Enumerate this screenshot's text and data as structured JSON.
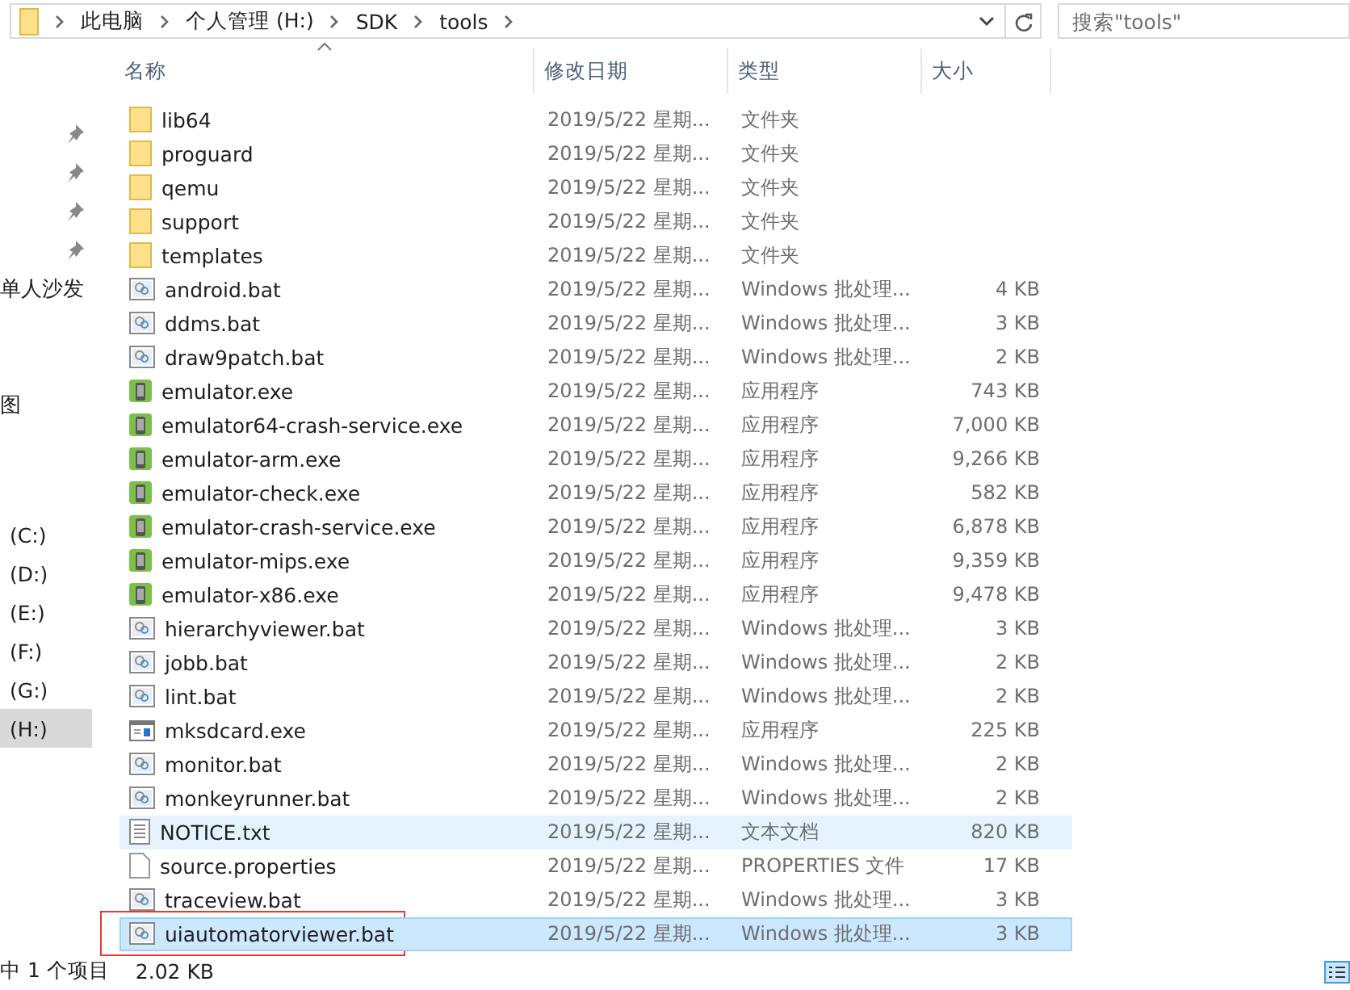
{
  "address_bar": {
    "crumbs": [
      "此电脑",
      "个人管理 (H:)",
      "SDK",
      "tools"
    ]
  },
  "search": {
    "placeholder": "搜索\"tools\""
  },
  "sidebar": {
    "quick_access": [
      {
        "pinned": true
      },
      {
        "pinned": true
      },
      {
        "pinned": true
      },
      {
        "pinned": true
      },
      {
        "label": "单人沙发",
        "pinned": false
      },
      {
        "pinned": false
      },
      {
        "pinned": false
      },
      {
        "label": "图",
        "pinned": false
      }
    ],
    "drives": [
      {
        "label": "(C:)",
        "selected": false
      },
      {
        "label": "(D:)",
        "selected": false
      },
      {
        "label": "(E:)",
        "selected": false
      },
      {
        "label": "(F:)",
        "selected": false
      },
      {
        "label": "(G:)",
        "selected": false
      },
      {
        "label": "(H:)",
        "selected": true
      }
    ]
  },
  "table": {
    "columns": [
      "名称",
      "修改日期",
      "类型",
      "大小"
    ],
    "rows": [
      {
        "kind": "folder",
        "name": "lib64",
        "date": "2019/5/22 星期...",
        "type": "文件夹",
        "size": "",
        "selected": false,
        "hovered": false,
        "annotated": false
      },
      {
        "kind": "folder",
        "name": "proguard",
        "date": "2019/5/22 星期...",
        "type": "文件夹",
        "size": "",
        "selected": false,
        "hovered": false,
        "annotated": false
      },
      {
        "kind": "folder",
        "name": "qemu",
        "date": "2019/5/22 星期...",
        "type": "文件夹",
        "size": "",
        "selected": false,
        "hovered": false,
        "annotated": false
      },
      {
        "kind": "folder",
        "name": "support",
        "date": "2019/5/22 星期...",
        "type": "文件夹",
        "size": "",
        "selected": false,
        "hovered": false,
        "annotated": false
      },
      {
        "kind": "folder",
        "name": "templates",
        "date": "2019/5/22 星期...",
        "type": "文件夹",
        "size": "",
        "selected": false,
        "hovered": false,
        "annotated": false
      },
      {
        "kind": "bat",
        "name": "android.bat",
        "date": "2019/5/22 星期...",
        "type": "Windows 批处理...",
        "size": "4 KB",
        "selected": false,
        "hovered": false,
        "annotated": false
      },
      {
        "kind": "bat",
        "name": "ddms.bat",
        "date": "2019/5/22 星期...",
        "type": "Windows 批处理...",
        "size": "3 KB",
        "selected": false,
        "hovered": false,
        "annotated": false
      },
      {
        "kind": "bat",
        "name": "draw9patch.bat",
        "date": "2019/5/22 星期...",
        "type": "Windows 批处理...",
        "size": "2 KB",
        "selected": false,
        "hovered": false,
        "annotated": false
      },
      {
        "kind": "exe",
        "name": "emulator.exe",
        "date": "2019/5/22 星期...",
        "type": "应用程序",
        "size": "743 KB",
        "selected": false,
        "hovered": false,
        "annotated": false
      },
      {
        "kind": "exe",
        "name": "emulator64-crash-service.exe",
        "date": "2019/5/22 星期...",
        "type": "应用程序",
        "size": "7,000 KB",
        "selected": false,
        "hovered": false,
        "annotated": false
      },
      {
        "kind": "exe",
        "name": "emulator-arm.exe",
        "date": "2019/5/22 星期...",
        "type": "应用程序",
        "size": "9,266 KB",
        "selected": false,
        "hovered": false,
        "annotated": false
      },
      {
        "kind": "exe",
        "name": "emulator-check.exe",
        "date": "2019/5/22 星期...",
        "type": "应用程序",
        "size": "582 KB",
        "selected": false,
        "hovered": false,
        "annotated": false
      },
      {
        "kind": "exe",
        "name": "emulator-crash-service.exe",
        "date": "2019/5/22 星期...",
        "type": "应用程序",
        "size": "6,878 KB",
        "selected": false,
        "hovered": false,
        "annotated": false
      },
      {
        "kind": "exe",
        "name": "emulator-mips.exe",
        "date": "2019/5/22 星期...",
        "type": "应用程序",
        "size": "9,359 KB",
        "selected": false,
        "hovered": false,
        "annotated": false
      },
      {
        "kind": "exe",
        "name": "emulator-x86.exe",
        "date": "2019/5/22 星期...",
        "type": "应用程序",
        "size": "9,478 KB",
        "selected": false,
        "hovered": false,
        "annotated": false
      },
      {
        "kind": "bat",
        "name": "hierarchyviewer.bat",
        "date": "2019/5/22 星期...",
        "type": "Windows 批处理...",
        "size": "3 KB",
        "selected": false,
        "hovered": false,
        "annotated": false
      },
      {
        "kind": "bat",
        "name": "jobb.bat",
        "date": "2019/5/22 星期...",
        "type": "Windows 批处理...",
        "size": "2 KB",
        "selected": false,
        "hovered": false,
        "annotated": false
      },
      {
        "kind": "bat",
        "name": "lint.bat",
        "date": "2019/5/22 星期...",
        "type": "Windows 批处理...",
        "size": "2 KB",
        "selected": false,
        "hovered": false,
        "annotated": false
      },
      {
        "kind": "app",
        "name": "mksdcard.exe",
        "date": "2019/5/22 星期...",
        "type": "应用程序",
        "size": "225 KB",
        "selected": false,
        "hovered": false,
        "annotated": false
      },
      {
        "kind": "bat",
        "name": "monitor.bat",
        "date": "2019/5/22 星期...",
        "type": "Windows 批处理...",
        "size": "2 KB",
        "selected": false,
        "hovered": false,
        "annotated": false
      },
      {
        "kind": "bat",
        "name": "monkeyrunner.bat",
        "date": "2019/5/22 星期...",
        "type": "Windows 批处理...",
        "size": "2 KB",
        "selected": false,
        "hovered": false,
        "annotated": false
      },
      {
        "kind": "text",
        "name": "NOTICE.txt",
        "date": "2019/5/22 星期...",
        "type": "文本文档",
        "size": "820 KB",
        "selected": false,
        "hovered": true,
        "annotated": false
      },
      {
        "kind": "file",
        "name": "source.properties",
        "date": "2019/5/22 星期...",
        "type": "PROPERTIES 文件",
        "size": "17 KB",
        "selected": false,
        "hovered": false,
        "annotated": false
      },
      {
        "kind": "bat",
        "name": "traceview.bat",
        "date": "2019/5/22 星期...",
        "type": "Windows 批处理...",
        "size": "3 KB",
        "selected": false,
        "hovered": false,
        "annotated": false
      },
      {
        "kind": "bat",
        "name": "uiautomatorviewer.bat",
        "date": "2019/5/22 星期...",
        "type": "Windows 批处理...",
        "size": "3 KB",
        "selected": true,
        "hovered": false,
        "annotated": true
      }
    ]
  },
  "status_bar": {
    "selection": "中 1 个项目",
    "size": "2.02 KB"
  }
}
